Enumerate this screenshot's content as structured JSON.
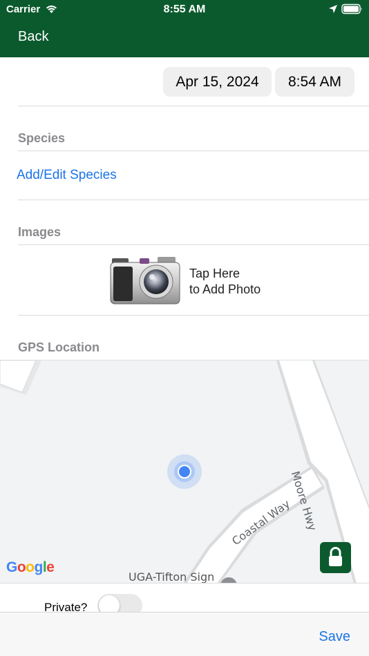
{
  "status_bar": {
    "carrier": "Carrier",
    "time": "8:55 AM",
    "icons": [
      "wifi-icon",
      "location-arrow-icon",
      "battery-icon"
    ]
  },
  "nav": {
    "back_label": "Back",
    "bar_color": "#0b5a2e"
  },
  "datetime": {
    "date": "Apr 15, 2024",
    "time": "8:54 AM"
  },
  "species": {
    "heading": "Species",
    "link_label": "Add/Edit Species"
  },
  "images": {
    "heading": "Images",
    "tap_line1": "Tap Here",
    "tap_line2": "to Add Photo",
    "icon": "camera-icon"
  },
  "gps": {
    "heading": "GPS Location",
    "map": {
      "roads": [
        "Moore Hwy",
        "Coastal Way"
      ],
      "place_label": "UGA-Tifton Sign",
      "attribution": "Google",
      "lock_icon": "lock-icon"
    }
  },
  "private": {
    "label": "Private?",
    "enabled": false
  },
  "toolbar": {
    "save_label": "Save"
  },
  "colors": {
    "accent": "#1a73e8",
    "brand": "#0b5a2e",
    "section_label": "#8a8a8e"
  }
}
